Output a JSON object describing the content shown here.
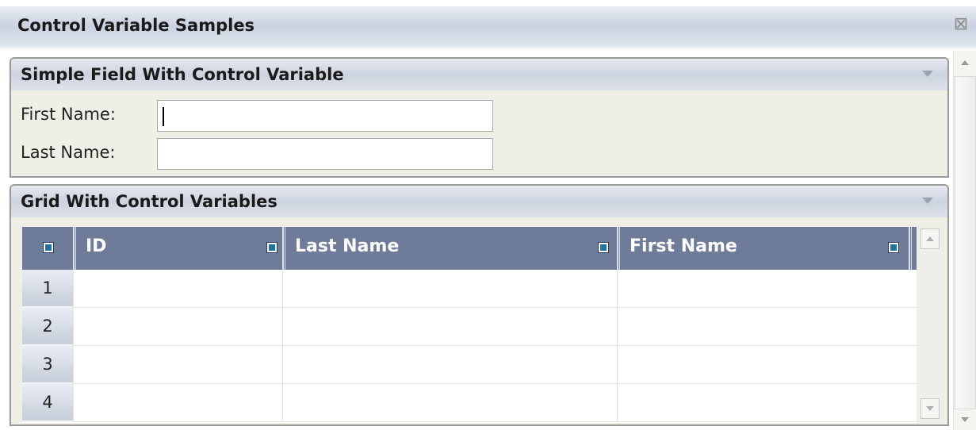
{
  "window": {
    "title": "Control Variable Samples",
    "close_icon": "close-icon"
  },
  "panel_simple": {
    "title": "Simple Field With Control Variable",
    "first_name_label": "First Name:",
    "first_name_value": "",
    "last_name_label": "Last Name:",
    "last_name_value": ""
  },
  "panel_grid": {
    "title": "Grid With Control Variables",
    "columns": [
      "ID",
      "Last Name",
      "First Name"
    ],
    "rows": [
      {
        "num": "1",
        "id": "",
        "last_name": "",
        "first_name": ""
      },
      {
        "num": "2",
        "id": "",
        "last_name": "",
        "first_name": ""
      },
      {
        "num": "3",
        "id": "",
        "last_name": "",
        "first_name": ""
      },
      {
        "num": "4",
        "id": "",
        "last_name": "",
        "first_name": ""
      }
    ]
  },
  "colors": {
    "grid_header": "#6e7b99",
    "panel_bg": "#f0efe6",
    "selector_fill": "#1f6f9f"
  }
}
